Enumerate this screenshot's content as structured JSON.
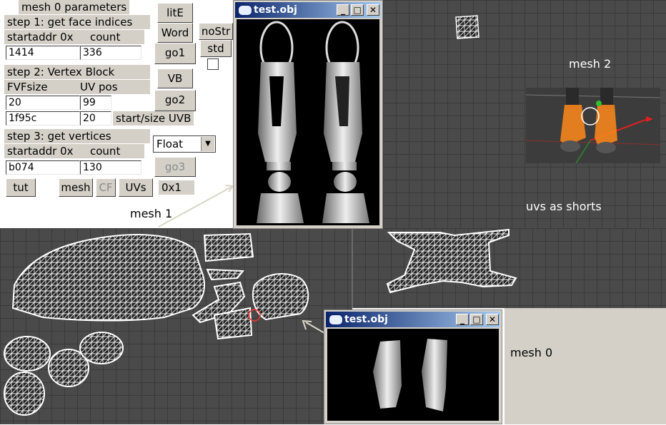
{
  "panel": {
    "title": "mesh 0 parameters",
    "step1": {
      "heading": "step 1: get face indices",
      "col1": "startaddr 0x",
      "col2": "count",
      "addr": "1414",
      "count": "336"
    },
    "step2": {
      "heading": "step 2: Vertex Block",
      "col1": "FVFsize",
      "col2": "UV pos",
      "fvf": "20",
      "uvpos": "99",
      "start": "1f95c",
      "size": "20",
      "startsize_label": "start/size UVB"
    },
    "step3": {
      "heading": "step 3: get vertices",
      "col1": "startaddr 0x",
      "col2": "count",
      "addr": "b074",
      "count": "130",
      "type": "Float"
    },
    "buttons": {
      "lite": "litE",
      "word": "Word",
      "nostr": "noStr",
      "std": "std",
      "go1": "go1",
      "vb": "VB",
      "go2": "go2",
      "go3": "go3",
      "tut": "tut",
      "mesh": "mesh",
      "cf": "CF",
      "uvs": "UVs"
    },
    "hex_label": "0x1"
  },
  "annotations": {
    "mesh1": "mesh 1",
    "mesh2": "mesh 2",
    "mesh0": "mesh 0",
    "uvs_shorts": "uvs as shorts"
  },
  "windows": {
    "top_title": "test.obj",
    "bottom_title": "test.obj",
    "min": "_",
    "max": "□",
    "close": "✕"
  },
  "colors": {
    "titlebar": "#0a246a",
    "viewport": "#4a4a4a",
    "orange": "#ff8a1a"
  }
}
